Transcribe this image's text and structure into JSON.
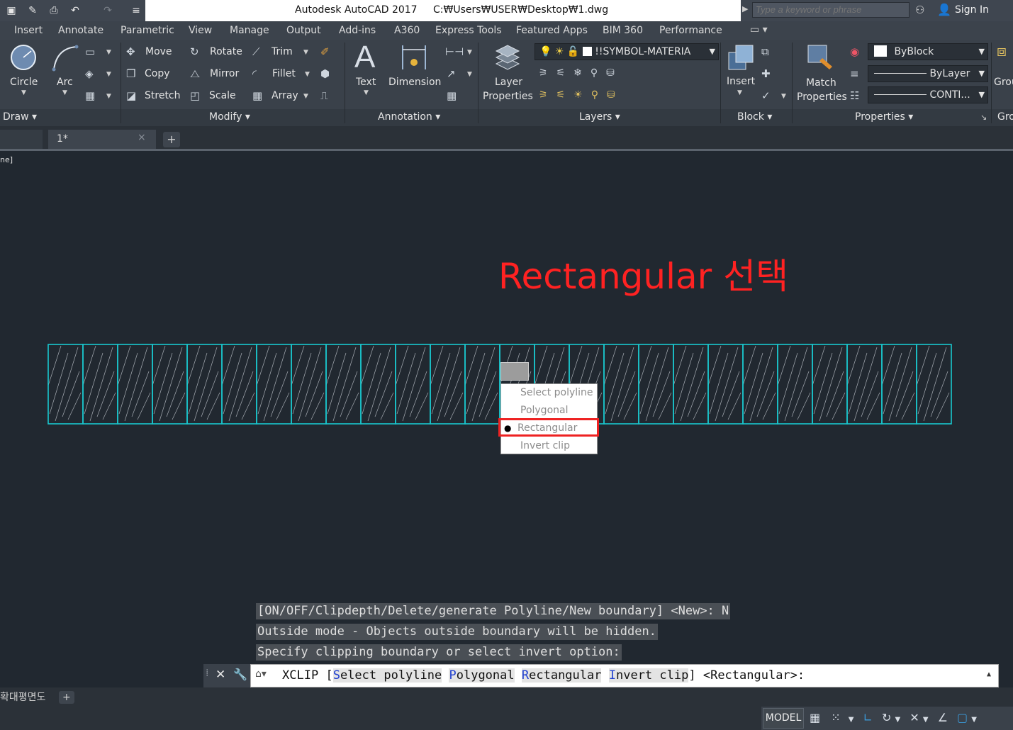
{
  "quick_access": {
    "icons": [
      "save-icon",
      "save-as-icon",
      "print-icon",
      "undo-icon",
      "redo-icon",
      "customize-icon"
    ]
  },
  "title": {
    "app": "Autodesk AutoCAD 2017",
    "path": "C:₩Users₩USER₩Desktop₩1.dwg"
  },
  "search": {
    "placeholder": "Type a keyword or phrase"
  },
  "account": {
    "sign_in": "Sign In"
  },
  "ribbon_tabs": [
    "Insert",
    "Annotate",
    "Parametric",
    "View",
    "Manage",
    "Output",
    "Add-ins",
    "A360",
    "Express Tools",
    "Featured Apps",
    "BIM 360",
    "Performance"
  ],
  "ribbon": {
    "draw": {
      "circle": "Circle",
      "arc": "Arc",
      "footer": "Draw"
    },
    "modify": {
      "move": "Move",
      "rotate": "Rotate",
      "trim": "Trim",
      "copy": "Copy",
      "mirror": "Mirror",
      "fillet": "Fillet",
      "stretch": "Stretch",
      "scale": "Scale",
      "array": "Array",
      "footer": "Modify"
    },
    "annotation": {
      "text": "Text",
      "dimension": "Dimension",
      "footer": "Annotation"
    },
    "layers": {
      "layer_properties_1": "Layer",
      "layer_properties_2": "Properties",
      "current_layer": "!!SYMBOL-MATERIA",
      "footer": "Layers"
    },
    "block": {
      "insert": "Insert",
      "footer": "Block"
    },
    "properties": {
      "match_1": "Match",
      "match_2": "Properties",
      "color": "ByBlock",
      "linetype": "ByLayer",
      "lineweight": "CONTI...",
      "footer": "Properties"
    },
    "groups": {
      "label": "Grou",
      "footer": "Gro"
    }
  },
  "doc_tabs": {
    "current": "1*",
    "close": "×",
    "new": "+"
  },
  "canvas": {
    "corner_label": "ne]",
    "annotation": "Rectangular 선택",
    "hatch_cells": 26,
    "hatch_color": "#19c8cf"
  },
  "context_menu": {
    "items": [
      {
        "label": "Select polyline",
        "selected": false
      },
      {
        "label": "Polygonal",
        "selected": false
      },
      {
        "label": "Rectangular",
        "selected": true
      },
      {
        "label": "Invert clip",
        "selected": false
      }
    ]
  },
  "history": [
    "[ON/OFF/Clipdepth/Delete/generate Polyline/New boundary] <New>: N",
    "Outside mode - Objects outside boundary will be hidden.",
    "Specify clipping boundary or select invert option:"
  ],
  "command": {
    "name": "XCLIP",
    "open": "[",
    "options": [
      {
        "key": "S",
        "rest": "elect polyline"
      },
      {
        "key": "P",
        "rest": "olygonal"
      },
      {
        "key": "R",
        "rest": "ectangular"
      },
      {
        "key": "I",
        "rest": "nvert clip"
      }
    ],
    "close": "]",
    "default": "<Rectangular>:"
  },
  "layout_tabs": {
    "current": "확대평면도",
    "new": "+"
  },
  "status": {
    "model": "MODEL"
  },
  "colors": {
    "annotation": "#ff2222",
    "highlight": "#ee2222",
    "hatch": "#19c8cf",
    "canvas": "#212830"
  }
}
